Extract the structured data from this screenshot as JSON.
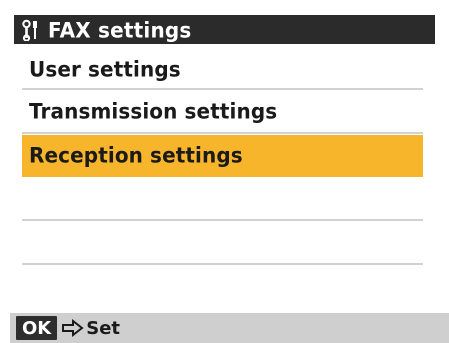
{
  "header": {
    "title": "FAX settings",
    "icon": "tools-icon"
  },
  "menu": {
    "items": [
      {
        "label": "User settings",
        "selected": false
      },
      {
        "label": "Transmission settings",
        "selected": false
      },
      {
        "label": "Reception settings",
        "selected": true
      },
      {
        "label": "",
        "selected": false
      },
      {
        "label": "",
        "selected": false
      }
    ]
  },
  "footer": {
    "key_label": "OK",
    "arrow_icon": "arrow-right-icon",
    "action_label": "Set"
  },
  "colors": {
    "title_bar": "#2b2b2b",
    "highlight": "#f6b52b",
    "footer_bar": "#cfcfcf",
    "separator": "#d2d2d2"
  }
}
